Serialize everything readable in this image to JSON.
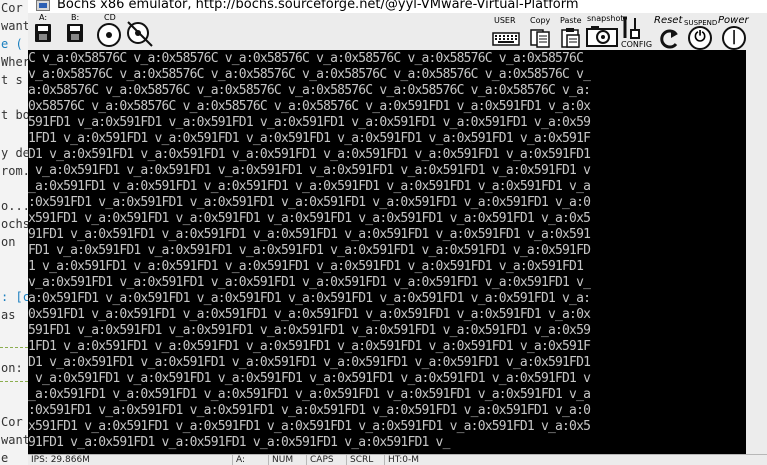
{
  "background_editor": {
    "lines": [
      {
        "text": "Cor"
      },
      {
        "text": "want"
      },
      {
        "text": "e ("
      },
      {
        "text": "Wher"
      },
      {
        "text": "t s"
      },
      {
        "text": "t bo"
      },
      {
        "text": "y de"
      },
      {
        "text": "rom."
      },
      {
        "text": "o..."
      },
      {
        "text": "ochs"
      },
      {
        "text": "on"
      },
      {
        "text": ": [c"
      },
      {
        "text": "as"
      },
      {
        "text": "on:"
      },
      {
        "text": "Cor"
      },
      {
        "text": "want"
      },
      {
        "text": "e"
      }
    ]
  },
  "window": {
    "title": "Bochs x86 emulator, http://bochs.sourceforge.net/@yyl-VMware-Virtual-Platform"
  },
  "toolbar": {
    "floppy_a": {
      "label": "A:",
      "icon": "floppy-icon"
    },
    "floppy_b": {
      "label": "B:",
      "icon": "floppy-icon"
    },
    "cdrom": {
      "label": "CD",
      "icon": "cdrom-icon"
    },
    "boot": {
      "icon": "boot-icon"
    },
    "user": {
      "label": "USER",
      "icon": "keyboard-icon"
    },
    "copy": {
      "label": "Copy",
      "icon": "copy-icon"
    },
    "paste": {
      "label": "Paste",
      "icon": "paste-icon"
    },
    "snapshot": {
      "label": "snapshot",
      "icon": "camera-icon"
    },
    "config": {
      "label": "CONFIG",
      "icon": "config-icon"
    },
    "reset": {
      "label": "Reset",
      "icon": "reset-icon"
    },
    "suspend": {
      "label": "SUSPEND",
      "icon": "suspend-icon"
    },
    "power": {
      "label": "Power",
      "icon": "power-icon"
    }
  },
  "screen": {
    "lines": [
      "C v_a:0x58576C v_a:0x58576C v_a:0x58576C v_a:0x58576C v_a:0x58576C v_a:0x58576C",
      "v_a:0x58576C v_a:0x58576C v_a:0x58576C v_a:0x58576C v_a:0x58576C v_a:0x58576C v_",
      "a:0x58576C v_a:0x58576C v_a:0x58576C v_a:0x58576C v_a:0x58576C v_a:0x58576C v_a:",
      "0x58576C v_a:0x58576C v_a:0x58576C v_a:0x58576C v_a:0x591FD1 v_a:0x591FD1 v_a:0x",
      "591FD1 v_a:0x591FD1 v_a:0x591FD1 v_a:0x591FD1 v_a:0x591FD1 v_a:0x591FD1 v_a:0x59",
      "1FD1 v_a:0x591FD1 v_a:0x591FD1 v_a:0x591FD1 v_a:0x591FD1 v_a:0x591FD1 v_a:0x591F",
      "D1 v_a:0x591FD1 v_a:0x591FD1 v_a:0x591FD1 v_a:0x591FD1 v_a:0x591FD1 v_a:0x591FD1",
      " v_a:0x591FD1 v_a:0x591FD1 v_a:0x591FD1 v_a:0x591FD1 v_a:0x591FD1 v_a:0x591FD1 v",
      "_a:0x591FD1 v_a:0x591FD1 v_a:0x591FD1 v_a:0x591FD1 v_a:0x591FD1 v_a:0x591FD1 v_a",
      ":0x591FD1 v_a:0x591FD1 v_a:0x591FD1 v_a:0x591FD1 v_a:0x591FD1 v_a:0x591FD1 v_a:0",
      "x591FD1 v_a:0x591FD1 v_a:0x591FD1 v_a:0x591FD1 v_a:0x591FD1 v_a:0x591FD1 v_a:0x5",
      "91FD1 v_a:0x591FD1 v_a:0x591FD1 v_a:0x591FD1 v_a:0x591FD1 v_a:0x591FD1 v_a:0x591",
      "FD1 v_a:0x591FD1 v_a:0x591FD1 v_a:0x591FD1 v_a:0x591FD1 v_a:0x591FD1 v_a:0x591FD",
      "1 v_a:0x591FD1 v_a:0x591FD1 v_a:0x591FD1 v_a:0x591FD1 v_a:0x591FD1 v_a:0x591FD1 ",
      "v_a:0x591FD1 v_a:0x591FD1 v_a:0x591FD1 v_a:0x591FD1 v_a:0x591FD1 v_a:0x591FD1 v_",
      "a:0x591FD1 v_a:0x591FD1 v_a:0x591FD1 v_a:0x591FD1 v_a:0x591FD1 v_a:0x591FD1 v_a:",
      "0x591FD1 v_a:0x591FD1 v_a:0x591FD1 v_a:0x591FD1 v_a:0x591FD1 v_a:0x591FD1 v_a:0x",
      "591FD1 v_a:0x591FD1 v_a:0x591FD1 v_a:0x591FD1 v_a:0x591FD1 v_a:0x591FD1 v_a:0x59",
      "1FD1 v_a:0x591FD1 v_a:0x591FD1 v_a:0x591FD1 v_a:0x591FD1 v_a:0x591FD1 v_a:0x591F",
      "D1 v_a:0x591FD1 v_a:0x591FD1 v_a:0x591FD1 v_a:0x591FD1 v_a:0x591FD1 v_a:0x591FD1",
      " v_a:0x591FD1 v_a:0x591FD1 v_a:0x591FD1 v_a:0x591FD1 v_a:0x591FD1 v_a:0x591FD1 v",
      "_a:0x591FD1 v_a:0x591FD1 v_a:0x591FD1 v_a:0x591FD1 v_a:0x591FD1 v_a:0x591FD1 v_a",
      ":0x591FD1 v_a:0x591FD1 v_a:0x591FD1 v_a:0x591FD1 v_a:0x591FD1 v_a:0x591FD1 v_a:0",
      "x591FD1 v_a:0x591FD1 v_a:0x591FD1 v_a:0x591FD1 v_a:0x591FD1 v_a:0x591FD1 v_a:0x5",
      "91FD1 v_a:0x591FD1 v_a:0x591FD1 v_a:0x591FD1 v_a:0x591FD1 v_"
    ]
  },
  "statusbar": {
    "ips": "IPS: 29.866M",
    "drive": "A:",
    "num": "NUM",
    "caps": "CAPS",
    "scrl": "SCRL",
    "ht": "HT:0-M"
  },
  "colors": {
    "screen_bg": "#000000",
    "screen_text": "#c6c6c6",
    "chrome": "#ececec"
  }
}
